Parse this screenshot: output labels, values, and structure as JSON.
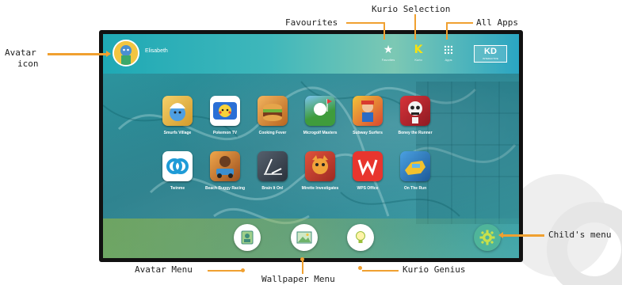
{
  "user": {
    "name": "Elisabeth"
  },
  "top_bar": {
    "favourites_caption": "Favorites",
    "kurio_caption": "Kurio",
    "apps_caption": "Apps",
    "logo_mark": "KD",
    "logo_sub": "INTERACTIVE"
  },
  "apps": [
    {
      "label": "Smurfs Village",
      "icon": "smurfs-village-icon",
      "color": "#e8b53a"
    },
    {
      "label": "Pokemon TV",
      "icon": "pokemon-tv-icon",
      "color": "#ffffff"
    },
    {
      "label": "Cooking Fever",
      "icon": "cooking-fever-icon",
      "color": "#d98a38"
    },
    {
      "label": "Microgolf Masters",
      "icon": "microgolf-icon",
      "color": "#4cb14a"
    },
    {
      "label": "Subway Surfers",
      "icon": "subway-surfers-icon",
      "color": "#e34c3a"
    },
    {
      "label": "Boney the Runner",
      "icon": "boney-runner-icon",
      "color": "#b5202a"
    },
    {
      "label": "Twinme",
      "icon": "twinme-icon",
      "color": "#1e9bd7"
    },
    {
      "label": "Beach Buggy Racing",
      "icon": "beach-buggy-icon",
      "color": "#d9762e"
    },
    {
      "label": "Brain It On!",
      "icon": "brain-it-on-icon",
      "color": "#3b4552"
    },
    {
      "label": "Mirette Investigates",
      "icon": "mirette-icon",
      "color": "#c43a2e"
    },
    {
      "label": "WPS Office",
      "icon": "wps-office-icon",
      "color": "#e8352e"
    },
    {
      "label": "On The Run",
      "icon": "on-the-run-icon",
      "color": "#2f7fc1"
    }
  ],
  "bottom_buttons": {
    "avatar_menu_icon": "avatar-card-icon",
    "wallpaper_menu_icon": "picture-icon",
    "kurio_genius_icon": "lightbulb-icon",
    "childs_menu_icon": "gear-icon"
  },
  "callouts": {
    "avatar_icon_line1": "Avatar",
    "avatar_icon_line2": "icon",
    "favourites": "Favourites",
    "kurio_selection": "Kurio Selection",
    "all_apps": "All Apps",
    "childs_menu": "Child's menu",
    "avatar_menu": "Avatar Menu",
    "wallpaper_menu": "Wallpaper Menu",
    "kurio_genius": "Kurio Genius"
  },
  "colors": {
    "accent": "#f0a030",
    "screen_teal": "#1f7f8c",
    "kurio_yellow": "#f6e20f"
  }
}
